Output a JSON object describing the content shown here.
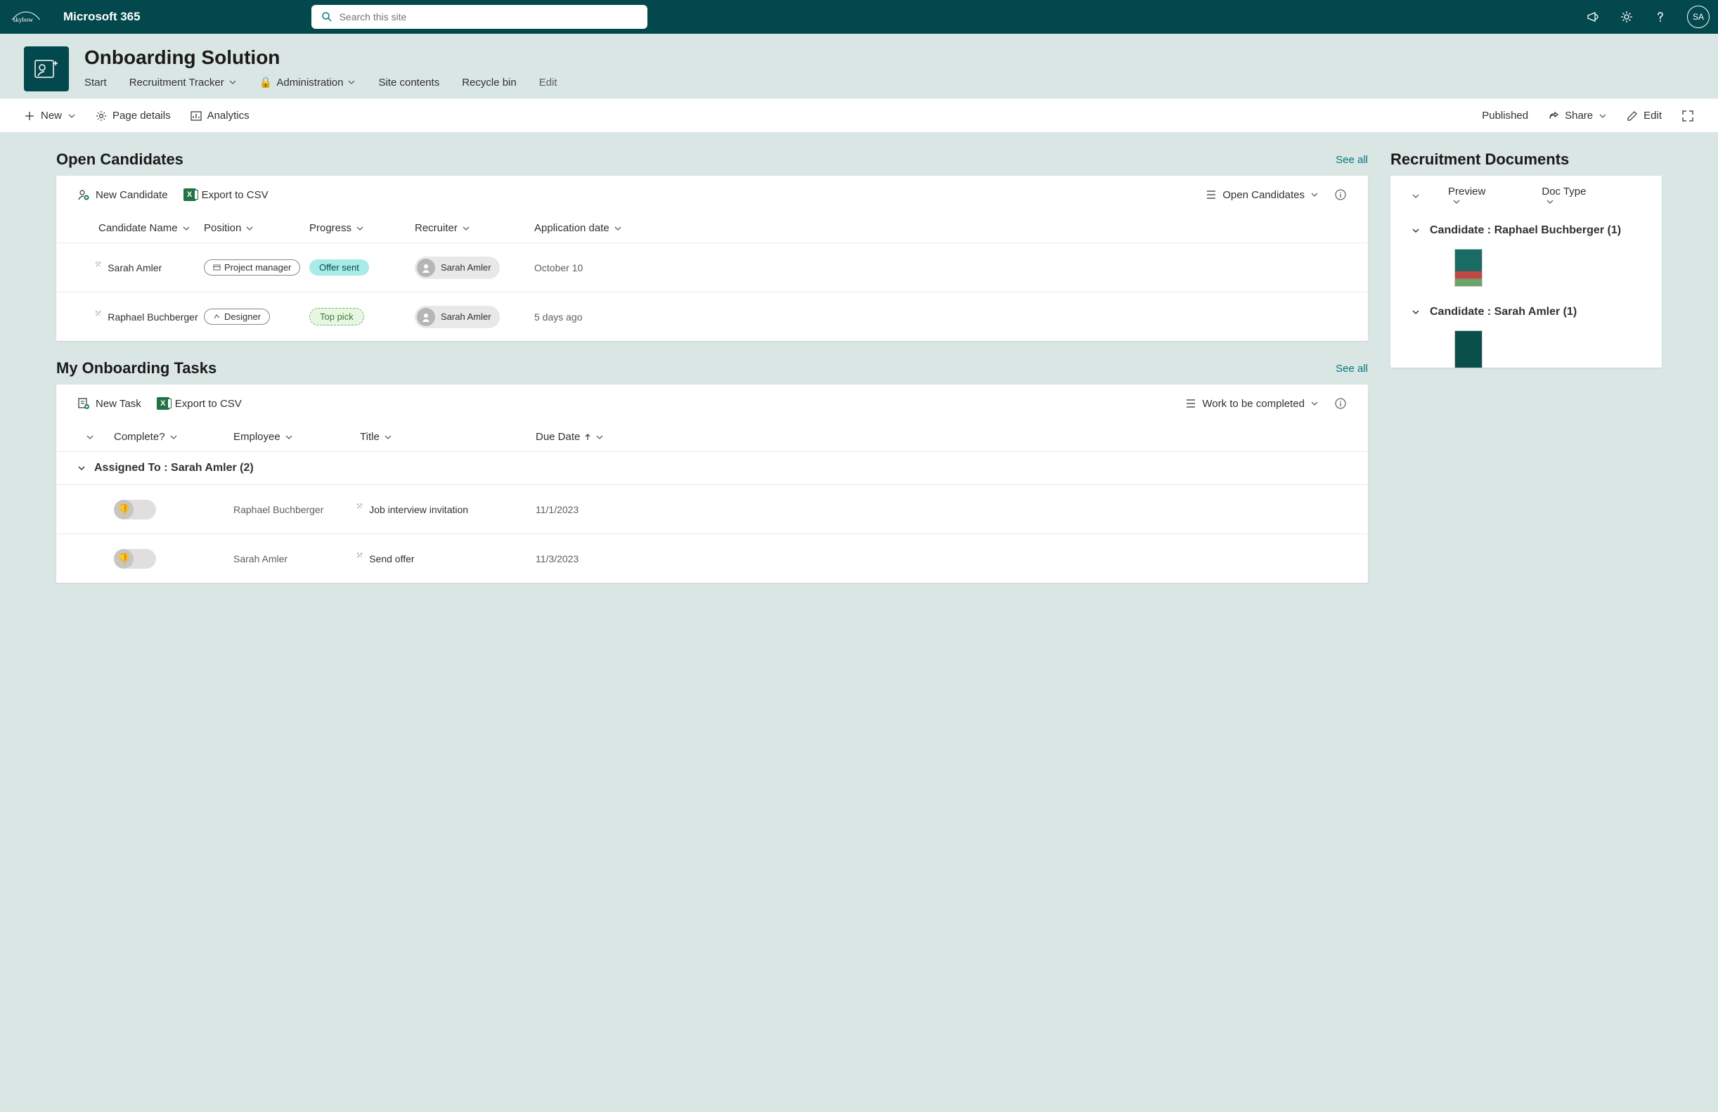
{
  "suite": {
    "brand": "skybow",
    "product": "Microsoft 365",
    "search_placeholder": "Search this site",
    "avatar_initials": "SA"
  },
  "site": {
    "title": "Onboarding Solution",
    "nav": {
      "start": "Start",
      "recruitment": "Recruitment Tracker",
      "admin": "Administration",
      "contents": "Site contents",
      "recycle": "Recycle bin",
      "edit": "Edit"
    }
  },
  "cmdbar": {
    "new": "New",
    "page_details": "Page details",
    "analytics": "Analytics",
    "published": "Published",
    "share": "Share",
    "edit": "Edit"
  },
  "candidates": {
    "title": "Open Candidates",
    "see_all": "See all",
    "toolbar": {
      "new_candidate": "New Candidate",
      "export": "Export to CSV",
      "view": "Open Candidates"
    },
    "columns": {
      "name": "Candidate Name",
      "position": "Position",
      "progress": "Progress",
      "recruiter": "Recruiter",
      "date": "Application date"
    },
    "rows": [
      {
        "name": "Sarah Amler",
        "position": "Project manager",
        "progress": "Offer sent",
        "recruiter": "Sarah Amler",
        "date": "October 10"
      },
      {
        "name": "Raphael Buchberger",
        "position": "Designer",
        "progress": "Top pick",
        "recruiter": "Sarah Amler",
        "date": "5 days ago"
      }
    ]
  },
  "tasks": {
    "title": "My Onboarding Tasks",
    "see_all": "See all",
    "toolbar": {
      "new_task": "New Task",
      "export": "Export to CSV",
      "view": "Work to be completed"
    },
    "columns": {
      "complete": "Complete?",
      "employee": "Employee",
      "title": "Title",
      "due": "Due Date"
    },
    "group_label": "Assigned To : Sarah Amler (2)",
    "rows": [
      {
        "employee": "Raphael Buchberger",
        "title": "Job interview invitation",
        "due": "11/1/2023"
      },
      {
        "employee": "Sarah Amler",
        "title": "Send offer",
        "due": "11/3/2023"
      }
    ]
  },
  "docs": {
    "title": "Recruitment Documents",
    "columns": {
      "preview": "Preview",
      "doctype": "Doc Type"
    },
    "groups": [
      {
        "label": "Candidate : Raphael Buchberger (1)"
      },
      {
        "label": "Candidate : Sarah Amler (1)"
      }
    ]
  }
}
